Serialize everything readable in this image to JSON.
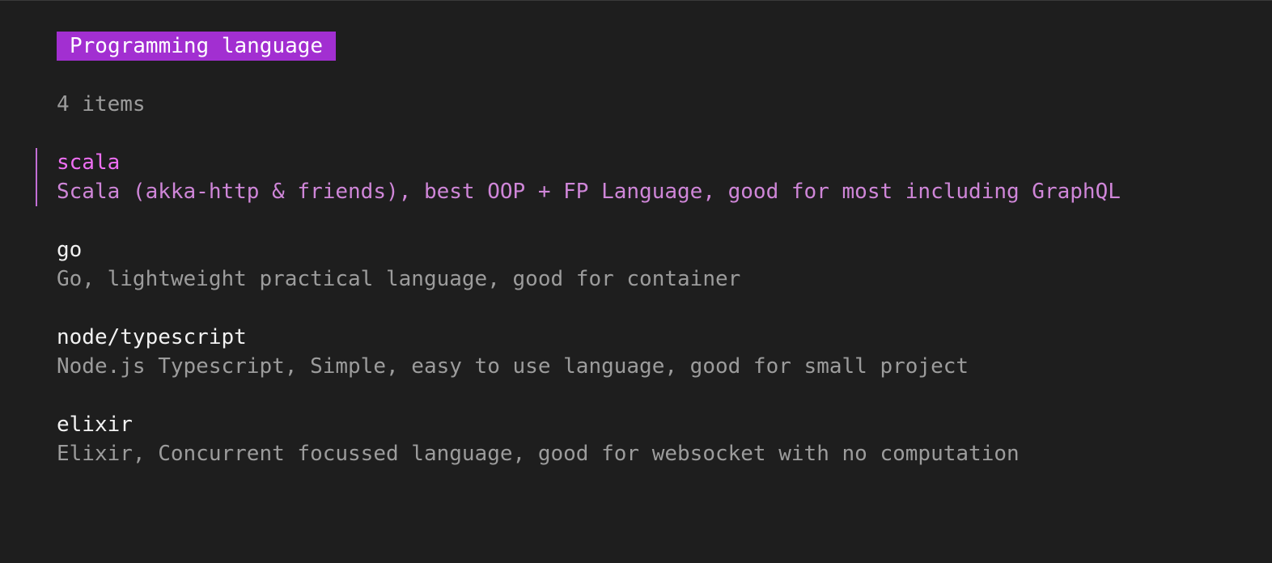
{
  "header": {
    "title": "Programming language",
    "badge_color": "#a22fd1"
  },
  "list": {
    "count_label": "4 items",
    "selected_index": 0,
    "items": [
      {
        "name": "scala",
        "description": "Scala (akka-http & friends), best OOP + FP Language, good for most including GraphQL"
      },
      {
        "name": "go",
        "description": "Go, lightweight practical language, good for container"
      },
      {
        "name": "node/typescript",
        "description": "Node.js Typescript, Simple, easy to use language, good for small project"
      },
      {
        "name": "elixir",
        "description": "Elixir, Concurrent focussed language, good for websocket with no computation"
      }
    ]
  },
  "colors": {
    "background": "#1e1e1e",
    "selected_title": "#ee6ff3",
    "selected_description": "#cf86d8",
    "text": "#f2f2f2",
    "muted": "#9c9c9c"
  }
}
